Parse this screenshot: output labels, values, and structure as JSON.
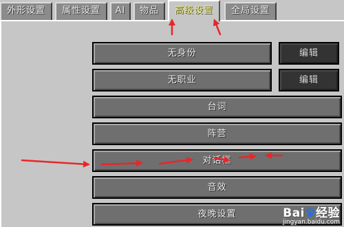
{
  "tabs": [
    {
      "label": "外形设置",
      "active": false
    },
    {
      "label": "属性设置",
      "active": false
    },
    {
      "label": "AI",
      "active": false
    },
    {
      "label": "物品",
      "active": false
    },
    {
      "label": "高级设置",
      "active": true
    },
    {
      "label": "全局设置",
      "active": false
    }
  ],
  "rows": [
    {
      "label": "无身份",
      "side_button": "编辑"
    },
    {
      "label": "无职业",
      "side_button": "编辑"
    },
    {
      "label": "台词"
    },
    {
      "label": "阵营"
    },
    {
      "label": "对话框"
    },
    {
      "label": "音效"
    },
    {
      "label": "夜晚设置"
    }
  ],
  "watermark": {
    "main_left": "Bai",
    "main_right": "经验",
    "sub": "jingyan.baidu.com"
  },
  "colors": {
    "arrow": "#e8262a",
    "active_tab_text": "#f1ef8a"
  }
}
